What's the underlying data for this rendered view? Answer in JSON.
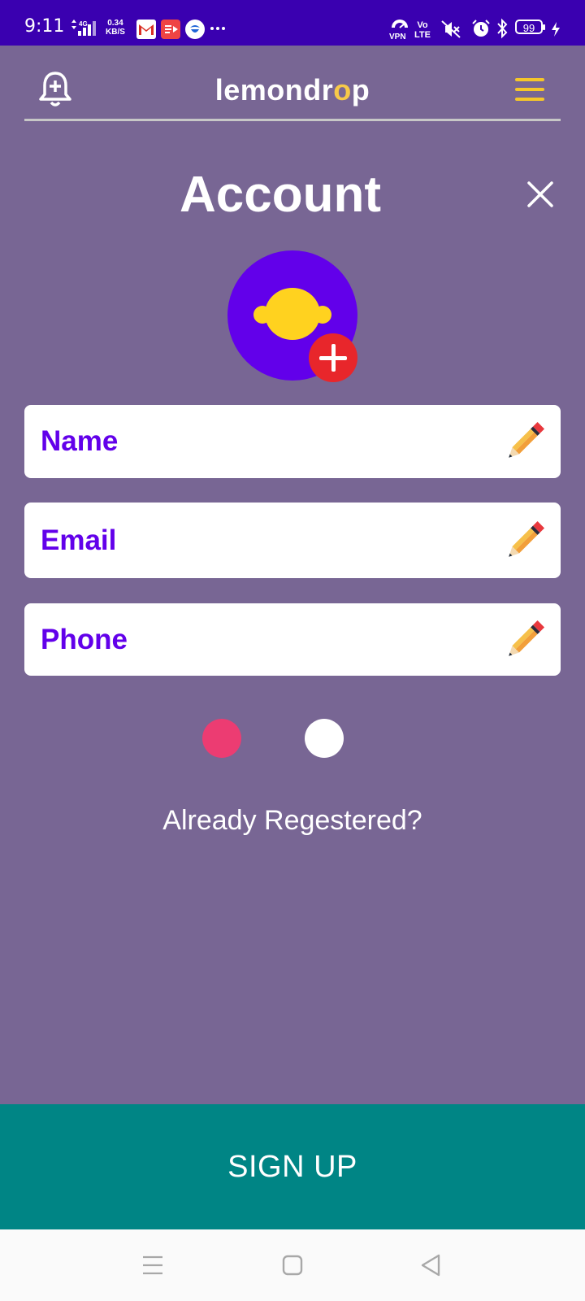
{
  "status_bar": {
    "time": "9:11",
    "network_type": "4G",
    "data_speed_value": "0.34",
    "data_speed_unit": "KB/S",
    "notification_icons": [
      "gmail-icon",
      "video-app-icon",
      "chat-app-icon",
      "more-dots-icon"
    ],
    "vpn_label": "VPN",
    "volte_top": "Vo",
    "volte_bottom": "LTE",
    "battery_level": "99",
    "colors": {
      "background": "#3a00b0"
    }
  },
  "header": {
    "brand_prefix": "lemondr",
    "brand_accent": "o",
    "brand_suffix": "p",
    "left_icon": "bell-add-icon",
    "right_icon": "hamburger-menu-icon"
  },
  "account": {
    "title": "Account",
    "close_icon": "close-icon",
    "avatar_icon": "lemon-icon",
    "add_photo_icon": "plus-circle-icon"
  },
  "form": {
    "fields": [
      {
        "label": "Name",
        "icon": "pencil-icon"
      },
      {
        "label": "Email",
        "icon": "pencil-icon"
      },
      {
        "label": "Phone",
        "icon": "pencil-icon"
      }
    ]
  },
  "pager": {
    "dots": [
      {
        "color": "#ec3c72",
        "active": true
      },
      {
        "color": "#ffffff",
        "active": false
      }
    ]
  },
  "already_registered": "Already Regestered?",
  "signup_button": "SIGN UP",
  "nav_bar": {
    "icons": [
      "recents-icon",
      "home-icon",
      "back-icon"
    ]
  },
  "colors": {
    "page_background": "#786694",
    "accent_purple": "#6200ea",
    "accent_yellow": "#f5c62a",
    "signup_teal": "#008585",
    "add_red": "#e8262b"
  }
}
